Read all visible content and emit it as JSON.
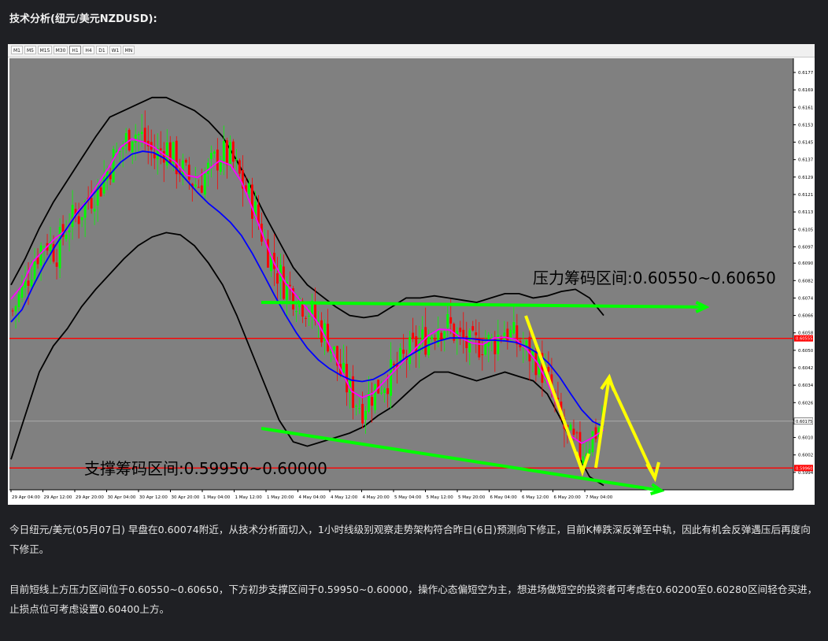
{
  "article": {
    "title": "技术分析(纽元/美元NZDUSD):",
    "paragraph1": "今日纽元/美元(05月07日) 早盘在0.60074附近，从技术分析面切入，1小时线级别观察走势架构符合昨日(6日)预测向下修正，目前K棒跌深反弹至中轨，因此有机会反弹遇压后再度向下修正。",
    "paragraph2": "目前短线上方压力区间位于0.60550~0.60650，下方初步支撑区间于0.59950~0.60000，操作心态偏短空为主，想进场做短空的投资者可考虑在0.60200至0.60280区间轻仓买进，止损点位可考虑设置0.60400上方。"
  },
  "toolbar": {
    "timeframes": [
      "M1",
      "M5",
      "M15",
      "M30",
      "H1",
      "H4",
      "D1",
      "W1",
      "MN"
    ],
    "active": "H1"
  },
  "annotations": {
    "resistance_label": "压力筹码区间:0.60550~0.60650",
    "support_label": "支撑筹码区间:0.59950~0.60000"
  },
  "colors": {
    "chart_bg": "#808080",
    "bull_candle": "#00ff00",
    "bear_candle": "#ff0000",
    "bollinger": "#000000",
    "ma_fast": "#ff00ff",
    "ma_slow": "#0000ff",
    "hline": "#ff0000",
    "trendline": "#00ff00",
    "projection": "#ffff00"
  },
  "chart_data": {
    "type": "candlestick",
    "symbol": "NZDUSD",
    "timeframe": "H1",
    "y_ticks": [
      "0.61775",
      "0.61695",
      "0.61615",
      "0.61535",
      "0.61455",
      "0.61375",
      "0.61295",
      "0.61215",
      "0.61135",
      "0.61055",
      "0.60975",
      "0.60900",
      "0.60820",
      "0.60740",
      "0.60660",
      "0.60580",
      "0.60500",
      "0.60420",
      "0.60340",
      "0.60260",
      "0.60180",
      "0.60100",
      "0.60020",
      "0.59940"
    ],
    "y_tick_values": [
      0.61775,
      0.61695,
      0.61615,
      0.61535,
      0.61455,
      0.61375,
      0.61295,
      0.61215,
      0.61135,
      0.61055,
      0.60975,
      0.609,
      0.6082,
      0.6074,
      0.6066,
      0.6058,
      0.605,
      0.6042,
      0.6034,
      0.6026,
      0.6018,
      0.601,
      0.6002,
      0.5994
    ],
    "ylim": [
      0.5986,
      0.6184
    ],
    "x_labels": [
      "29 Apr 04:00",
      "29 Apr 12:00",
      "29 Apr 20:00",
      "30 Apr 04:00",
      "30 Apr 12:00",
      "30 Apr 20:00",
      "1 May 04:00",
      "1 May 12:00",
      "1 May 20:00",
      "4 May 04:00",
      "4 May 12:00",
      "4 May 20:00",
      "5 May 04:00",
      "5 May 12:00",
      "5 May 20:00",
      "6 May 04:00",
      "6 May 12:00",
      "6 May 20:00",
      "7 May 04:00"
    ],
    "price_tags": [
      {
        "label": "0.60555",
        "value": 0.60555
      },
      {
        "label": "0.60175",
        "value": 0.60175
      },
      {
        "label": "0.59960",
        "value": 0.5996
      }
    ],
    "close_path": [
      0.6068,
      0.6079,
      0.6092,
      0.6101,
      0.6095,
      0.6108,
      0.6112,
      0.612,
      0.6125,
      0.6136,
      0.6143,
      0.6151,
      0.6147,
      0.6139,
      0.6144,
      0.6136,
      0.6129,
      0.6126,
      0.6133,
      0.614,
      0.6138,
      0.6127,
      0.6117,
      0.6101,
      0.6088,
      0.608,
      0.6075,
      0.607,
      0.6062,
      0.6055,
      0.604,
      0.603,
      0.6024,
      0.6031,
      0.6036,
      0.604,
      0.6047,
      0.6052,
      0.6056,
      0.6062,
      0.6061,
      0.6055,
      0.6051,
      0.6054,
      0.6053,
      0.606,
      0.6055,
      0.605,
      0.6046,
      0.6036,
      0.602,
      0.6009,
      0.6003,
      0.601,
      0.6017
    ],
    "bollinger_mid": [
      0.6058,
      0.6068,
      0.608,
      0.609,
      0.6097,
      0.6106,
      0.6113,
      0.6119,
      0.6124,
      0.6131,
      0.6137,
      0.6141,
      0.6142,
      0.6141,
      0.6139,
      0.6134,
      0.6128,
      0.6122,
      0.6117,
      0.6113,
      0.611,
      0.6103,
      0.6095,
      0.6085,
      0.6075,
      0.6066,
      0.6058,
      0.605,
      0.6045,
      0.6042,
      0.6038,
      0.6036,
      0.6035,
      0.6036,
      0.6039,
      0.6043,
      0.6047,
      0.605,
      0.6052,
      0.6055,
      0.6056,
      0.6056,
      0.6055,
      0.6055,
      0.6054,
      0.6055,
      0.6054,
      0.6052,
      0.6049,
      0.6045,
      0.6038,
      0.603,
      0.6022,
      0.6016,
      0.6014
    ],
    "bollinger_upper_path": [
      0.608,
      0.6092,
      0.6106,
      0.6118,
      0.6128,
      0.6138,
      0.6148,
      0.6157,
      0.616,
      0.6163,
      0.6166,
      0.6166,
      0.6163,
      0.616,
      0.6155,
      0.6148,
      0.6137,
      0.6125,
      0.6112,
      0.61,
      0.6088,
      0.608,
      0.6075,
      0.607,
      0.6066,
      0.6065,
      0.6066,
      0.607,
      0.6074,
      0.6074,
      0.6075,
      0.6074,
      0.6073,
      0.6072,
      0.6074,
      0.6076,
      0.6076,
      0.6074,
      0.6075,
      0.6077,
      0.6078,
      0.6074,
      0.6066
    ],
    "bollinger_lower_path": [
      0.6,
      0.602,
      0.604,
      0.6052,
      0.606,
      0.607,
      0.6078,
      0.6085,
      0.6092,
      0.6098,
      0.6102,
      0.6104,
      0.6103,
      0.6098,
      0.609,
      0.608,
      0.6066,
      0.605,
      0.6034,
      0.6018,
      0.6008,
      0.6006,
      0.6008,
      0.601,
      0.6012,
      0.6015,
      0.602,
      0.6024,
      0.603,
      0.6036,
      0.604,
      0.604,
      0.6038,
      0.6036,
      0.6038,
      0.604,
      0.6038,
      0.6036,
      0.603,
      0.6018,
      0.6004,
      0.5992,
      0.5988
    ]
  }
}
